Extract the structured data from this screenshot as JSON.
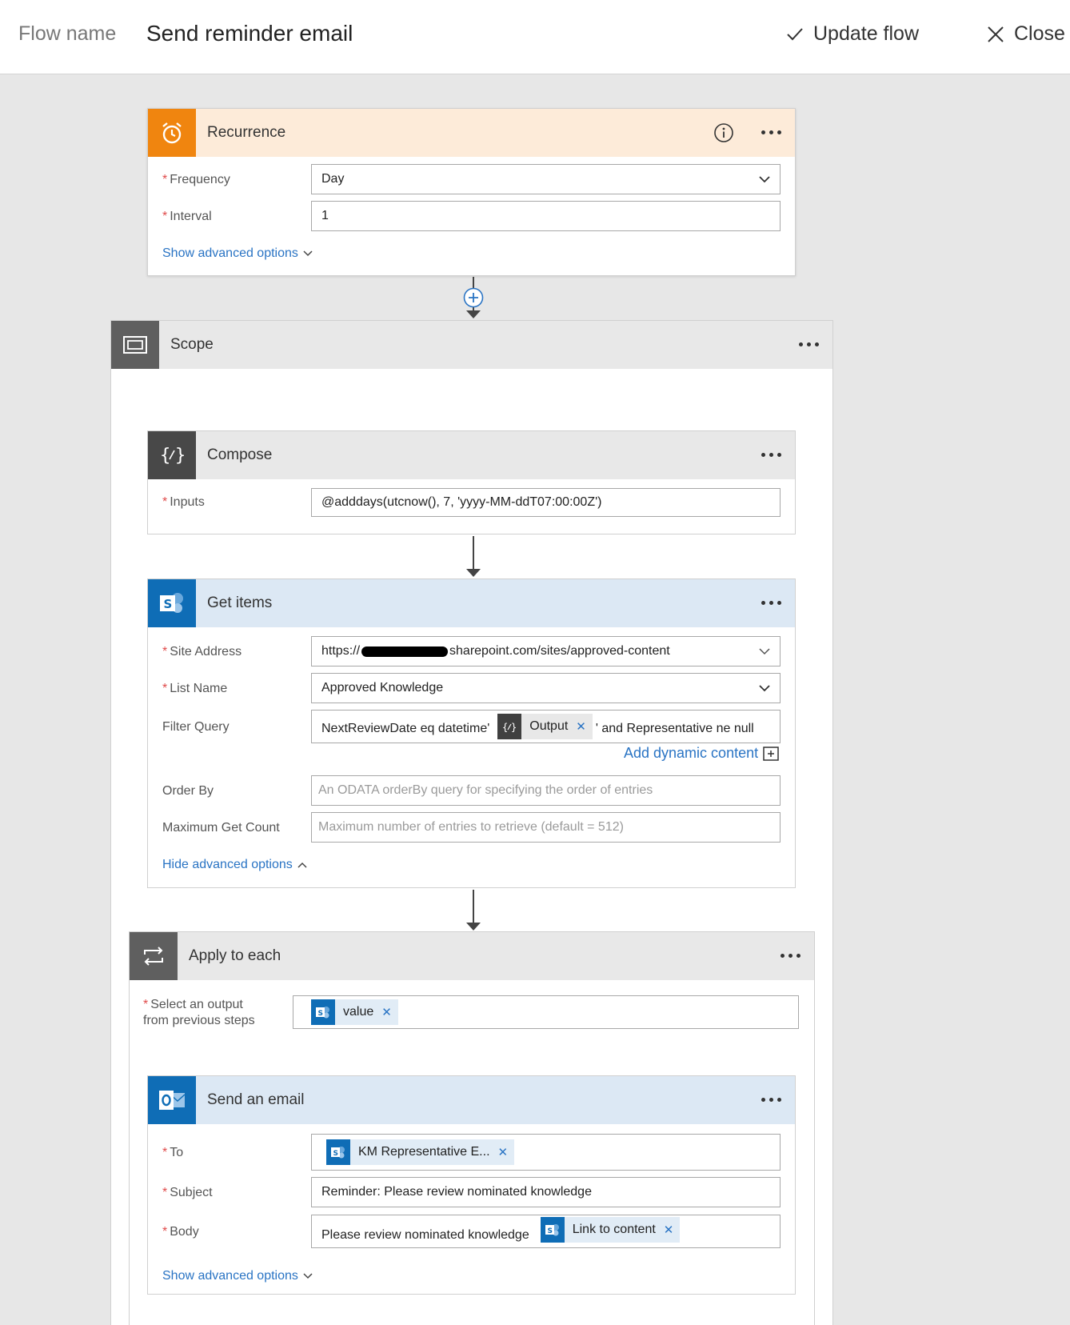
{
  "topbar": {
    "flow_label": "Flow name",
    "flow_name": "Send reminder email",
    "update_label": "Update flow",
    "close_label": "Close"
  },
  "recurrence": {
    "title": "Recurrence",
    "frequency_label": "Frequency",
    "frequency_value": "Day",
    "interval_label": "Interval",
    "interval_value": "1",
    "advanced_link": "Show advanced options"
  },
  "scope": {
    "title": "Scope"
  },
  "compose": {
    "title": "Compose",
    "inputs_label": "Inputs",
    "inputs_value": "@adddays(utcnow(), 7, 'yyyy-MM-ddT07:00:00Z')"
  },
  "get_items": {
    "title": "Get items",
    "site_label": "Site Address",
    "site_prefix": "https://",
    "site_suffix": "sharepoint.com/sites/approved-content",
    "list_label": "List Name",
    "list_value": "Approved Knowledge",
    "filter_label": "Filter Query",
    "filter_before": "NextReviewDate eq datetime'",
    "filter_token": "Output",
    "filter_after": "' and Representative ne null",
    "dynamic_link": "Add dynamic content",
    "order_label": "Order By",
    "order_placeholder": "An ODATA orderBy query for specifying the order of entries",
    "max_label": "Maximum Get Count",
    "max_placeholder": "Maximum number of entries to retrieve (default = 512)",
    "advanced_link": "Hide advanced options"
  },
  "apply_each": {
    "title": "Apply to each",
    "select_label_1": "Select an output",
    "select_label_2": "from previous steps",
    "select_token": "value"
  },
  "send_email": {
    "title": "Send an email",
    "to_label": "To",
    "to_token": "KM Representative E...",
    "subject_label": "Subject",
    "subject_value": "Reminder: Please review nominated knowledge",
    "body_label": "Body",
    "body_text": "Please review nominated knowledge",
    "body_token": "Link to content",
    "advanced_link": "Show advanced options"
  },
  "colors": {
    "recurrence_accent": "#f0850f",
    "recurrence_header": "#fdebd9",
    "sharepoint_blue": "#0f6db6",
    "sharepoint_header": "#dce8f4",
    "gray_header": "#e8e8e8",
    "dark_icon": "#484848",
    "link_blue": "#2a74c4"
  }
}
